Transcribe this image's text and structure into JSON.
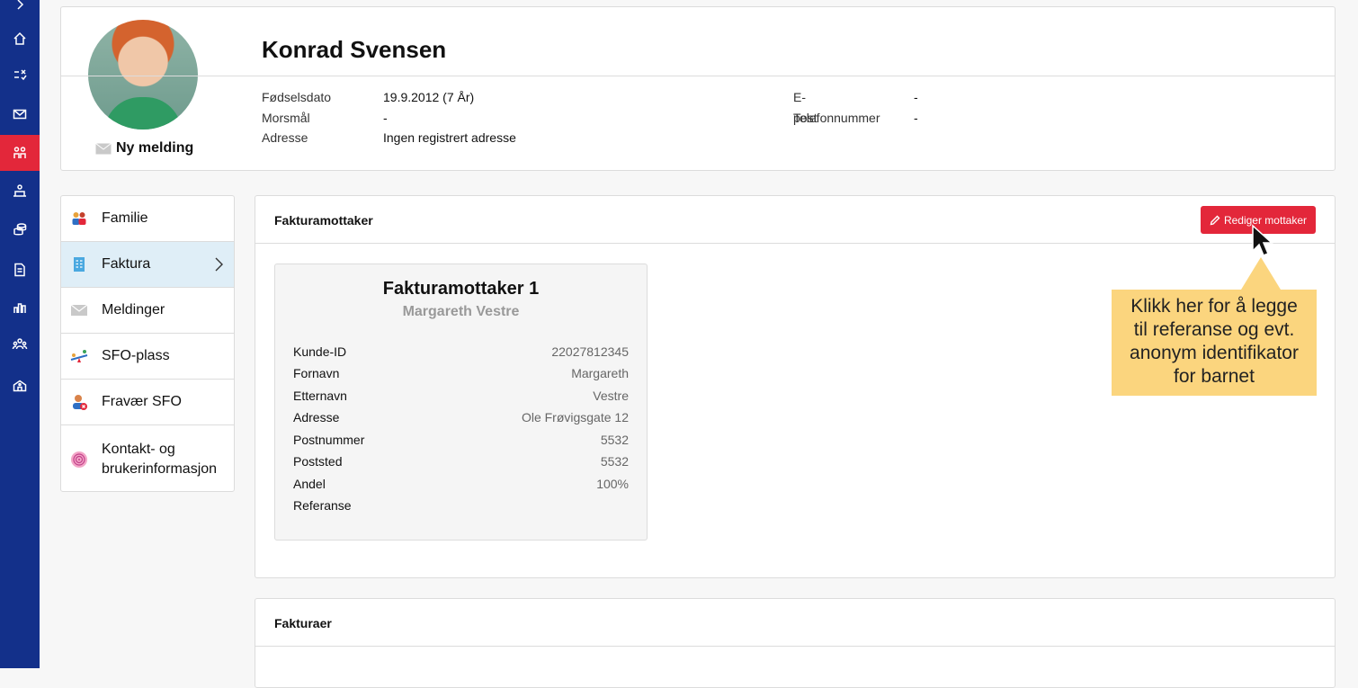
{
  "rail": [
    "chevron-right",
    "home",
    "tasks",
    "mail",
    "children",
    "classroom",
    "coins",
    "document",
    "chart",
    "groups",
    "school"
  ],
  "profile": {
    "name": "Konrad Svensen",
    "new_message": "Ny melding",
    "left_fields": [
      {
        "label": "Fødselsdato",
        "value": "19.9.2012 (7 År)"
      },
      {
        "label": "Morsmål",
        "value": "-"
      },
      {
        "label": "Adresse",
        "value": "Ingen registrert adresse"
      }
    ],
    "right_fields": [
      {
        "label": "E-post",
        "value": "-"
      },
      {
        "label": "Telefonnummer",
        "value": "-"
      }
    ]
  },
  "nav": {
    "familie": "Familie",
    "faktura": "Faktura",
    "meldinger": "Meldinger",
    "sfo_plass": "SFO-plass",
    "fravaer_sfo": "Fravær SFO",
    "kontakt_1": "Kontakt- og",
    "kontakt_2": "brukerinformasjon"
  },
  "fakturamottaker": {
    "title": "Fakturamottaker",
    "edit_label": "Rediger mottaker",
    "card_title": "Fakturamottaker 1",
    "card_sub": "Margareth Vestre",
    "rows": [
      {
        "k": "Kunde-ID",
        "v": "22027812345"
      },
      {
        "k": "Fornavn",
        "v": "Margareth"
      },
      {
        "k": "Etternavn",
        "v": "Vestre"
      },
      {
        "k": "Adresse",
        "v": "Ole Frøvigsgate 12"
      },
      {
        "k": "Postnummer",
        "v": "5532"
      },
      {
        "k": "Poststed",
        "v": "5532"
      },
      {
        "k": "Andel",
        "v": "100%"
      },
      {
        "k": "Referanse",
        "v": ""
      }
    ]
  },
  "tooltip": {
    "lines": [
      "Klikk her for å legge",
      "til referanse og evt.",
      "anonym identifikator",
      "for barnet"
    ]
  },
  "fakturaer": {
    "title": "Fakturaer"
  },
  "colors": {
    "rail": "#13308a",
    "accent": "#e3273a",
    "tooltip": "#fbd57e",
    "active_nav": "#dfeef7"
  }
}
